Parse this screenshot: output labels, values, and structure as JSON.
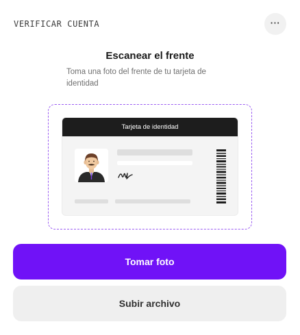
{
  "header": {
    "title": "VERIFICAR CUENTA",
    "more_icon": "more-horizontal-icon",
    "more_glyph": "···"
  },
  "scan": {
    "title": "Escanear el frente",
    "description": "Toma una foto del frente de tu tarjeta de identidad"
  },
  "id_card": {
    "header_label": "Tarjeta de identidad",
    "photo_icon": "person-portrait-icon",
    "signature_icon": "signature-icon",
    "barcode_icon": "barcode-icon"
  },
  "actions": {
    "take_photo_label": "Tomar foto",
    "upload_label": "Subir archivo"
  },
  "colors": {
    "accent": "#7012f7",
    "frame_dash": "#9b5cf2",
    "card_header": "#1d1d1d",
    "secondary_button": "#efefef"
  }
}
